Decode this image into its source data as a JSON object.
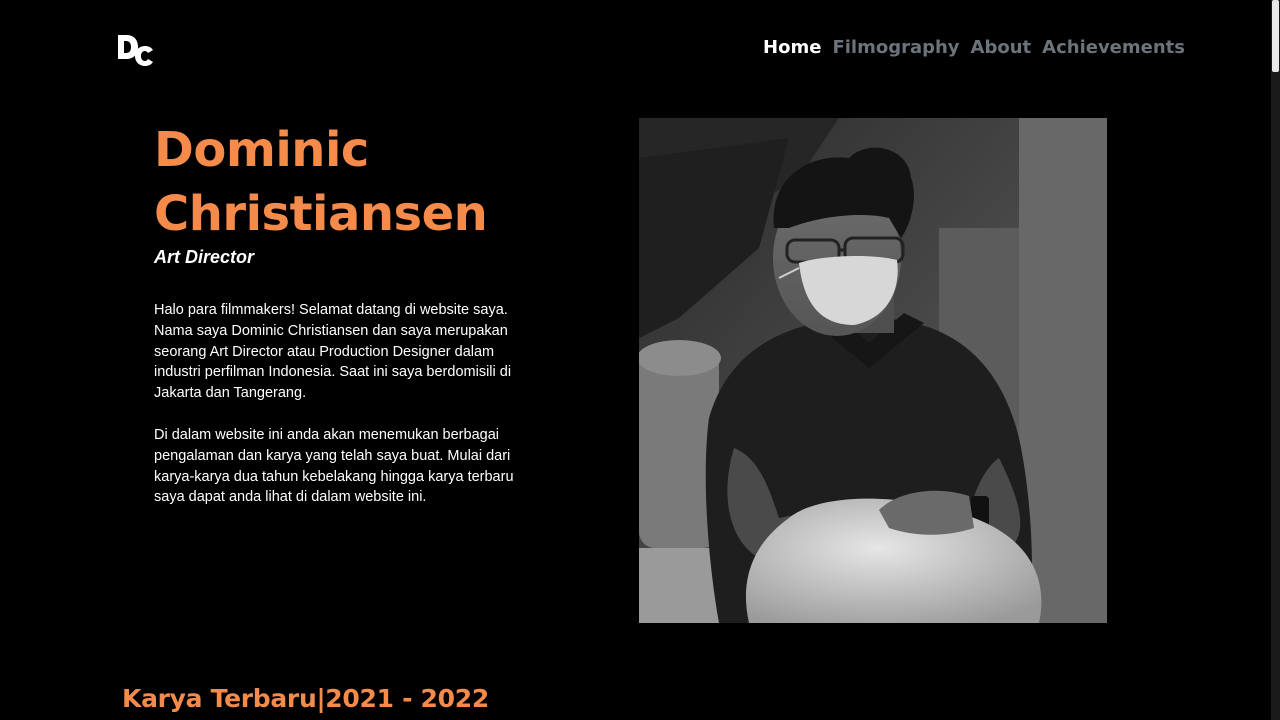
{
  "brand": {
    "logo_text": "DC"
  },
  "nav": {
    "items": [
      {
        "label": "Home",
        "active": true
      },
      {
        "label": "Filmography",
        "active": false
      },
      {
        "label": "About",
        "active": false
      },
      {
        "label": "Achievements",
        "active": false
      }
    ]
  },
  "hero": {
    "name_line1": "Dominic",
    "name_line2": "Christiansen",
    "role": "Art Director",
    "bio": [
      "Halo para filmmakers! Selamat datang di website saya. Nama saya Dominic Christiansen dan saya merupakan seorang Art Director atau Production Designer dalam industri perfilman Indonesia. Saat ini saya berdomisili di Jakarta dan Tangerang.",
      "Di dalam website ini anda akan menemukan berbagai pengalaman dan karya yang telah saya buat. Mulai dari karya-karya dua tahun kebelakang hingga karya terbaru saya dapat anda lihat di dalam website ini."
    ]
  },
  "works": {
    "title": "Karya Terbaru|2021 - 2022"
  },
  "colors": {
    "accent": "#f58b4a",
    "background": "#000000",
    "nav_active": "#ffffff",
    "nav_inactive": "#6c737b"
  }
}
